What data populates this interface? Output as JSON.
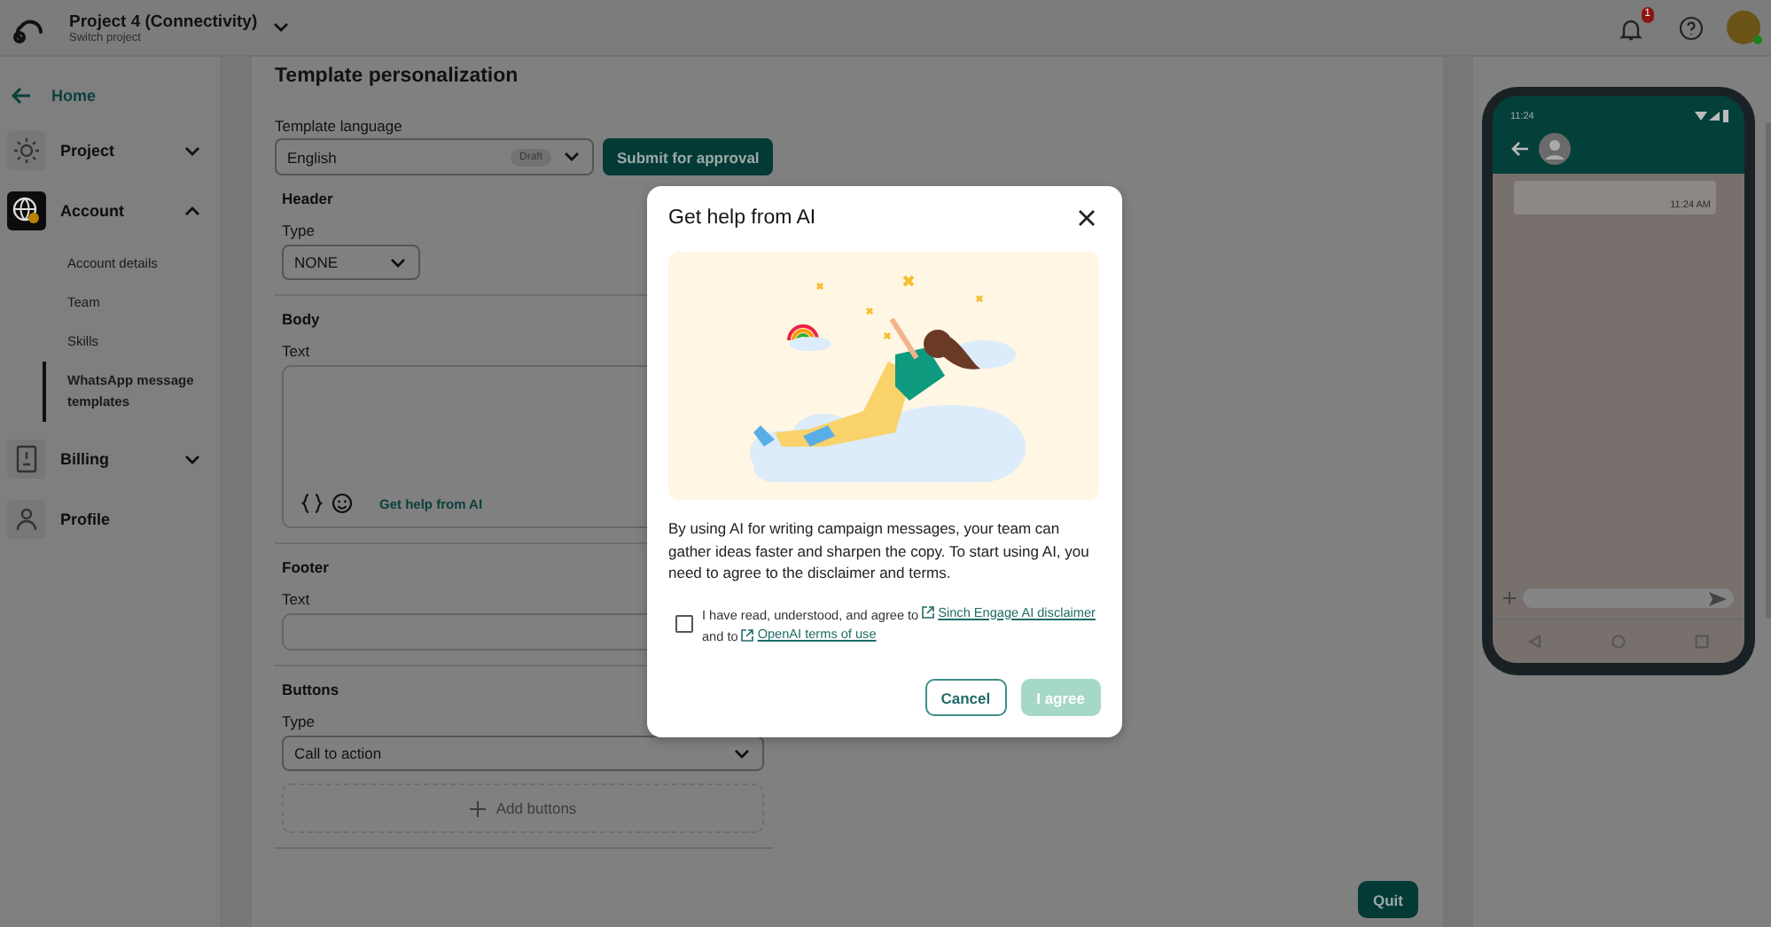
{
  "top_bar": {
    "project_name": "Project 4 (Connectivity)",
    "project_hint": "Switch project",
    "notification_count": "1"
  },
  "sidebar": {
    "back_link": "Home",
    "items": [
      {
        "label": "Project",
        "kind": "group",
        "expanded": false,
        "selected": false
      },
      {
        "label": "Account",
        "kind": "group",
        "expanded": true,
        "selected": true,
        "children": [
          {
            "label": "Account details",
            "selected": false
          },
          {
            "label": "Team",
            "selected": false
          },
          {
            "label": "Skills",
            "selected": false
          },
          {
            "label": "WhatsApp message templates",
            "selected": true
          }
        ]
      },
      {
        "label": "Billing",
        "kind": "group",
        "expanded": false,
        "selected": false
      },
      {
        "label": "Profile",
        "kind": "link",
        "selected": false
      }
    ]
  },
  "form": {
    "title": "Template personalization",
    "language": {
      "label": "Template language",
      "value": "English",
      "badge": "Draft"
    },
    "submit_button": "Submit for approval",
    "sections": [
      {
        "title": "Header",
        "fields": [
          {
            "kind": "short_select",
            "label": "Type",
            "value": "NONE"
          }
        ]
      },
      {
        "title": "Body",
        "fields": [
          {
            "kind": "textarea",
            "label": "Text",
            "ai_link": "Get help from AI"
          }
        ]
      },
      {
        "title": "Footer",
        "fields": [
          {
            "kind": "input",
            "label": "Text"
          }
        ]
      },
      {
        "title": "Buttons",
        "fields": [
          {
            "kind": "select",
            "label": "Type",
            "value": "Call to action"
          },
          {
            "kind": "add",
            "label": "Add buttons"
          }
        ]
      }
    ],
    "quit_button": "Quit"
  },
  "preview": {
    "status_time": "11:24",
    "message_time": "11:24 AM"
  },
  "dialog": {
    "title": "Get help from AI",
    "text": "By using AI for writing campaign messages, your team can gather ideas faster and sharpen the copy. To start using AI, you need to agree to the disclaimer and terms.",
    "consent": {
      "checked": false,
      "text_before": "I have read, understood, and agree to",
      "link_1": "Sinch Engage AI disclaimer",
      "text_middle": "and to",
      "link_2": "OpenAI terms of use"
    },
    "buttons": [
      {
        "label": "Cancel",
        "kind": "secondary",
        "disabled": false
      },
      {
        "label": "I agree",
        "kind": "primary",
        "disabled": true
      }
    ]
  }
}
